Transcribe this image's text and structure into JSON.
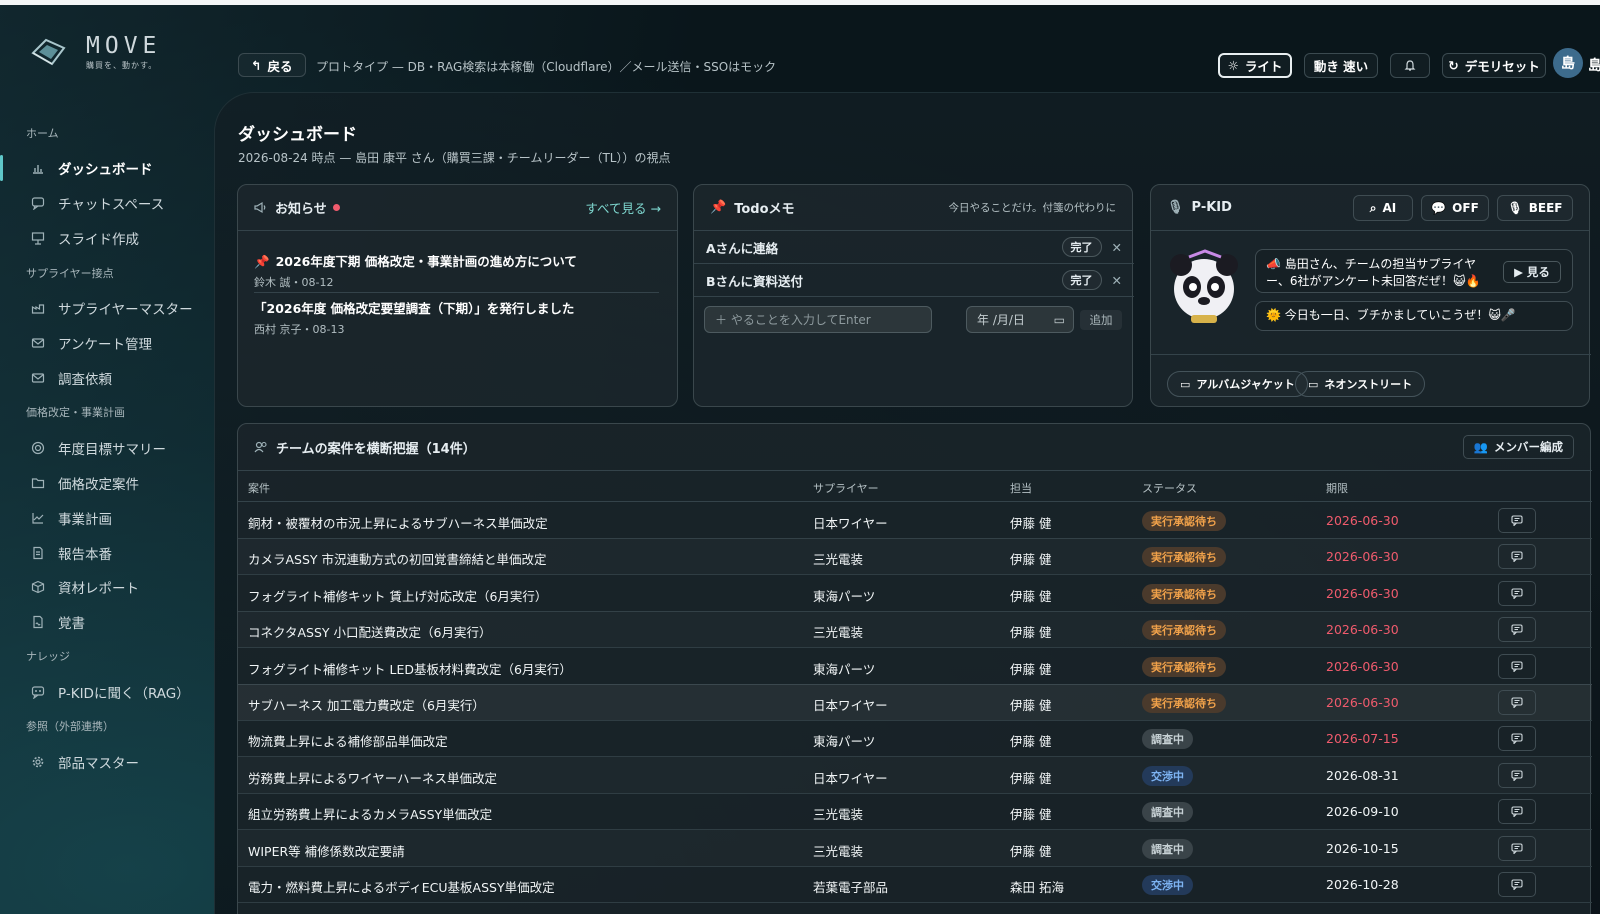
{
  "app": {
    "logo_text": "MOVE",
    "logo_tagline": "購買を、動かす。"
  },
  "sidebar": {
    "sections": [
      {
        "title": "ホーム",
        "items": [
          {
            "label": "ダッシュボード",
            "icon": "chart-icon",
            "active": true
          },
          {
            "label": "チャットスペース",
            "icon": "chat-icon"
          },
          {
            "label": "スライド作成",
            "icon": "presentation-icon"
          }
        ]
      },
      {
        "title": "サプライヤー接点",
        "items": [
          {
            "label": "サプライヤーマスター",
            "icon": "factory-icon"
          },
          {
            "label": "アンケート管理",
            "icon": "mail-icon"
          },
          {
            "label": "調査依頼",
            "icon": "mail-icon"
          }
        ]
      },
      {
        "title": "価格改定・事業計画",
        "items": [
          {
            "label": "年度目標サマリー",
            "icon": "target-icon"
          },
          {
            "label": "価格改定案件",
            "icon": "folder-icon"
          },
          {
            "label": "事業計画",
            "icon": "line-chart-icon"
          },
          {
            "label": "報告本番",
            "icon": "document-icon"
          },
          {
            "label": "資材レポート",
            "icon": "box-icon"
          },
          {
            "label": "覚書",
            "icon": "signed-document-icon"
          }
        ]
      },
      {
        "title": "ナレッジ",
        "items": [
          {
            "label": "P-KIDに聞く（RAG）",
            "icon": "bot-chat-icon"
          }
        ]
      },
      {
        "title": "参照（外部連携）",
        "items": [
          {
            "label": "部品マスター",
            "icon": "gear-icon"
          }
        ]
      }
    ]
  },
  "header": {
    "back_label": "戻る",
    "note": "プロトタイプ — DB・RAG検索は本稼働（Cloudflare）／メール送信・SSOはモック",
    "light_label": "ライト",
    "motion_label": "動き 速い",
    "reset_label": "デモリセット",
    "avatar_initial": "島",
    "user_name_partial": "島"
  },
  "page": {
    "title": "ダッシュボード",
    "subtitle": "2026-08-24 時点 — 島田 康平 さん（購買三課・チームリーダー（TL））の視点"
  },
  "notices": {
    "title": "お知らせ",
    "see_all": "すべて見る →",
    "items": [
      {
        "title": "2026年度下期 価格改定・事業計画の進め方について",
        "meta": "鈴木 誠・08-12",
        "pinned": true
      },
      {
        "title": "「2026年度 価格改定要望調査（下期）」を発行しました",
        "meta": "西村 京子・08-13",
        "pinned": false
      }
    ]
  },
  "todo": {
    "title": "Todoメモ",
    "hint": "今日やることだけ。付箋の代わりに",
    "items": [
      {
        "label": "Aさんに連絡",
        "done_label": "完了"
      },
      {
        "label": "Bさんに資料送付",
        "done_label": "完了"
      }
    ],
    "input_placeholder": "＋ やることを入力してEnter",
    "date_placeholder": "年 /月/日",
    "add_label": "追加"
  },
  "pkid": {
    "title": "P-KID",
    "btn_ai": "AI",
    "btn_off": "OFF",
    "btn_beef": "BEEF",
    "message1": "島田さん、チームの担当サプライヤー、6社がアンケート未回答だぜ！😺🔥",
    "view_label": "見る",
    "message2": "今日も一日、ブチかましていこうぜ！😺🎤",
    "chip1": "アルバムジャケット",
    "chip2": "ネオンストリート"
  },
  "cases": {
    "title": "チームの案件を横断把握（14件）",
    "member_edit_label": "メンバー編成",
    "columns": [
      "案件",
      "サプライヤー",
      "担当",
      "ステータス",
      "期限"
    ],
    "rows": [
      {
        "name": "銅材・被覆材の市況上昇によるサブハーネス単価改定",
        "supplier": "日本ワイヤー",
        "owner": "伊藤 健",
        "status": "実行承認待ち",
        "due": "2026-06-30",
        "overdue": true
      },
      {
        "name": "カメラASSY 市況連動方式の初回覚書締結と単価改定",
        "supplier": "三光電装",
        "owner": "伊藤 健",
        "status": "実行承認待ち",
        "due": "2026-06-30",
        "overdue": true
      },
      {
        "name": "フォグライト補修キット 賃上げ対応改定（6月実行）",
        "supplier": "東海パーツ",
        "owner": "伊藤 健",
        "status": "実行承認待ち",
        "due": "2026-06-30",
        "overdue": true
      },
      {
        "name": "コネクタASSY 小口配送費改定（6月実行）",
        "supplier": "三光電装",
        "owner": "伊藤 健",
        "status": "実行承認待ち",
        "due": "2026-06-30",
        "overdue": true
      },
      {
        "name": "フォグライト補修キット LED基板材料費改定（6月実行）",
        "supplier": "東海パーツ",
        "owner": "伊藤 健",
        "status": "実行承認待ち",
        "due": "2026-06-30",
        "overdue": true
      },
      {
        "name": "サブハーネス 加工電力費改定（6月実行）",
        "supplier": "日本ワイヤー",
        "owner": "伊藤 健",
        "status": "実行承認待ち",
        "due": "2026-06-30",
        "overdue": true
      },
      {
        "name": "物流費上昇による補修部品単価改定",
        "supplier": "東海パーツ",
        "owner": "伊藤 健",
        "status": "調査中",
        "due": "2026-07-15",
        "overdue": true
      },
      {
        "name": "労務費上昇によるワイヤーハーネス単価改定",
        "supplier": "日本ワイヤー",
        "owner": "伊藤 健",
        "status": "交渉中",
        "due": "2026-08-31",
        "overdue": false
      },
      {
        "name": "組立労務費上昇によるカメラASSY単価改定",
        "supplier": "三光電装",
        "owner": "伊藤 健",
        "status": "調査中",
        "due": "2026-09-10",
        "overdue": false
      },
      {
        "name": "WIPER等 補修係数改定要請",
        "supplier": "三光電装",
        "owner": "伊藤 健",
        "status": "調査中",
        "due": "2026-10-15",
        "overdue": false
      },
      {
        "name": "電力・燃料費上昇によるボディECU基板ASSY単価改定",
        "supplier": "若葉電子部品",
        "owner": "森田 拓海",
        "status": "交渉中",
        "due": "2026-10-28",
        "overdue": false
      }
    ]
  },
  "colors": {
    "accent": "#5fc7c9",
    "overdue": "#f05b6d",
    "wait": "#f0a14a",
    "negotiating": "#7db3f2"
  }
}
